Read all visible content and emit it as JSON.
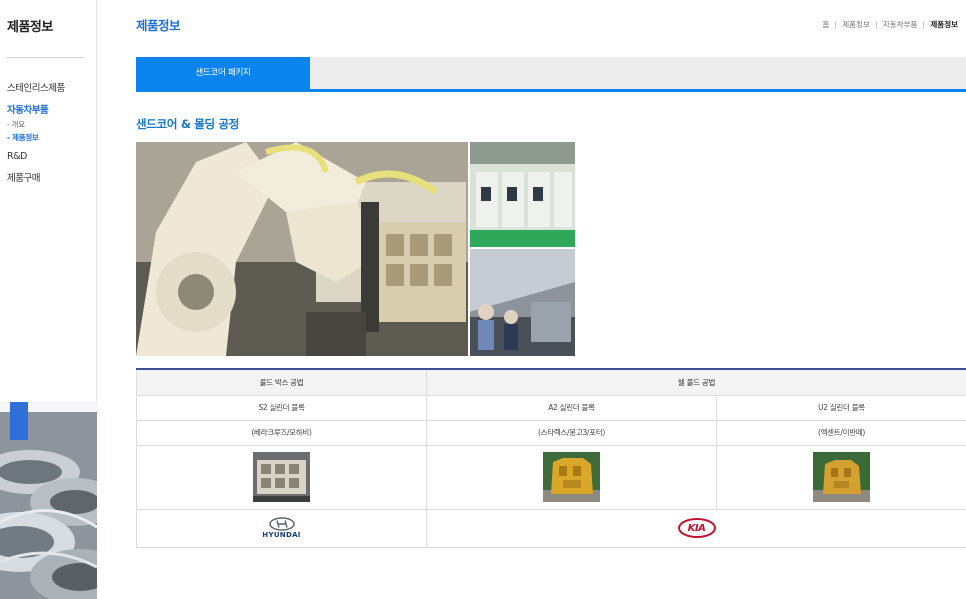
{
  "sidebar": {
    "title": "제품정보",
    "menu": [
      {
        "label": "스테인리스제품"
      },
      {
        "label": "자동차부품"
      },
      {
        "label": "R&D"
      },
      {
        "label": "제품구매"
      }
    ],
    "submenu": [
      {
        "label": "- 개요"
      },
      {
        "label": "- 제품정보"
      }
    ]
  },
  "header": {
    "title": "제품정보",
    "breadcrumb": [
      "홈",
      "제품정보",
      "자동차부품",
      "제품정보"
    ]
  },
  "tabs": [
    {
      "label": "샌드코어 패키지"
    }
  ],
  "section": {
    "title": "샌드코어 & 몰딩 공정"
  },
  "table": {
    "headers": [
      "콜드 박스 공법",
      "쉘 몰드 공법"
    ],
    "products": [
      "S2 실린더 블록",
      "A2 실린더 블록",
      "U2 실린더 블록"
    ],
    "vehicles": [
      "(베라크루즈/모하비)",
      "(스타렉스/봉고3/포터)",
      "(엑센트/이반떼)"
    ],
    "brands": [
      "HYUNDAI",
      "KIA"
    ]
  },
  "colors": {
    "accent": "#0c84f0",
    "title_blue": "#1f6fd6",
    "table_rule": "#3a4f97",
    "kia_red": "#c8102e"
  },
  "icons": [
    "hyundai-logo-icon",
    "kia-logo-icon"
  ]
}
